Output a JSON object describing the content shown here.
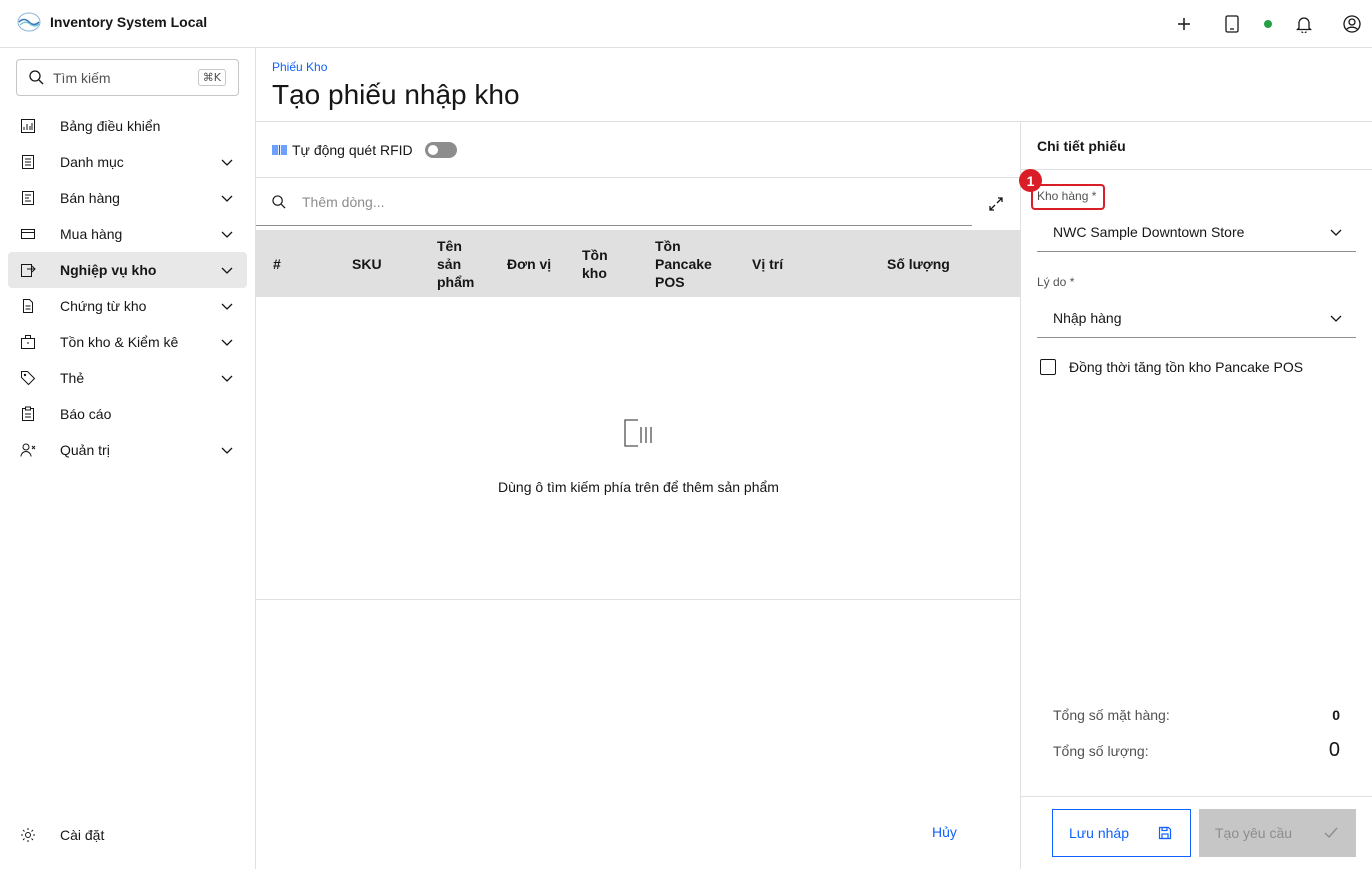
{
  "app": {
    "name": "Inventory System Local"
  },
  "topbar": {
    "icons": [
      "add-icon",
      "tablet-icon",
      "status-dot",
      "notification-icon",
      "user-icon"
    ],
    "status_color": "#24a148"
  },
  "sidebar": {
    "search_placeholder": "Tìm kiếm",
    "search_shortcut": "⌘K",
    "items": [
      {
        "label": "Bảng điều khiển",
        "icon": "dashboard-icon",
        "expandable": false
      },
      {
        "label": "Danh mục",
        "icon": "catalog-icon",
        "expandable": true
      },
      {
        "label": "Bán hàng",
        "icon": "sales-icon",
        "expandable": true
      },
      {
        "label": "Mua hàng",
        "icon": "purchase-icon",
        "expandable": true
      },
      {
        "label": "Nghiệp vụ kho",
        "icon": "warehouse-ops-icon",
        "expandable": true,
        "active": true
      },
      {
        "label": "Chứng từ kho",
        "icon": "document-icon",
        "expandable": true
      },
      {
        "label": "Tồn kho & Kiểm kê",
        "icon": "inventory-icon",
        "expandable": true
      },
      {
        "label": "Thẻ",
        "icon": "tag-icon",
        "expandable": true
      },
      {
        "label": "Báo cáo",
        "icon": "report-icon",
        "expandable": false
      },
      {
        "label": "Quản trị",
        "icon": "admin-icon",
        "expandable": true
      }
    ],
    "settings_label": "Cài đặt"
  },
  "header": {
    "breadcrumb": "Phiếu Kho",
    "title": "Tạo phiếu nhập kho"
  },
  "main": {
    "rfid_label": "Tự động quét RFID",
    "rfid_enabled": false,
    "add_row_placeholder": "Thêm dòng...",
    "columns": [
      "#",
      "SKU",
      "Tên sản phẩm",
      "Đơn vị",
      "Tồn kho",
      "Tồn Pancake POS",
      "Vị trí",
      "Số lượng"
    ],
    "columns_display": [
      [
        "#"
      ],
      [
        "SKU"
      ],
      [
        "Tên",
        "sản",
        "phẩm"
      ],
      [
        "Đơn vị"
      ],
      [
        "Tồn",
        "kho"
      ],
      [
        "Tồn",
        "Pancake",
        "POS"
      ],
      [
        "Vị trí"
      ],
      [
        "Số lượng"
      ]
    ],
    "empty_text": "Dùng ô tìm kiếm phía trên để thêm sản phẩm",
    "cancel_label": "Hủy"
  },
  "details": {
    "title": "Chi tiết phiếu",
    "step_badge": "1",
    "warehouse_label": "Kho hàng *",
    "warehouse_value": "NWC Sample Downtown Store",
    "reason_label": "Lý do *",
    "reason_value": "Nhập hàng",
    "pos_checkbox_label": "Đồng thời tăng tồn kho Pancake POS",
    "pos_checkbox_checked": false,
    "total_items_label": "Tổng số mặt hàng:",
    "total_items_value": "0",
    "total_qty_label": "Tổng số lượng:",
    "total_qty_value": "0",
    "save_draft_label": "Lưu nháp",
    "create_label": "Tạo yêu cầu"
  },
  "colors": {
    "accent": "#0f62fe",
    "danger": "#da1e28",
    "active_bg": "#e8e8e8"
  }
}
